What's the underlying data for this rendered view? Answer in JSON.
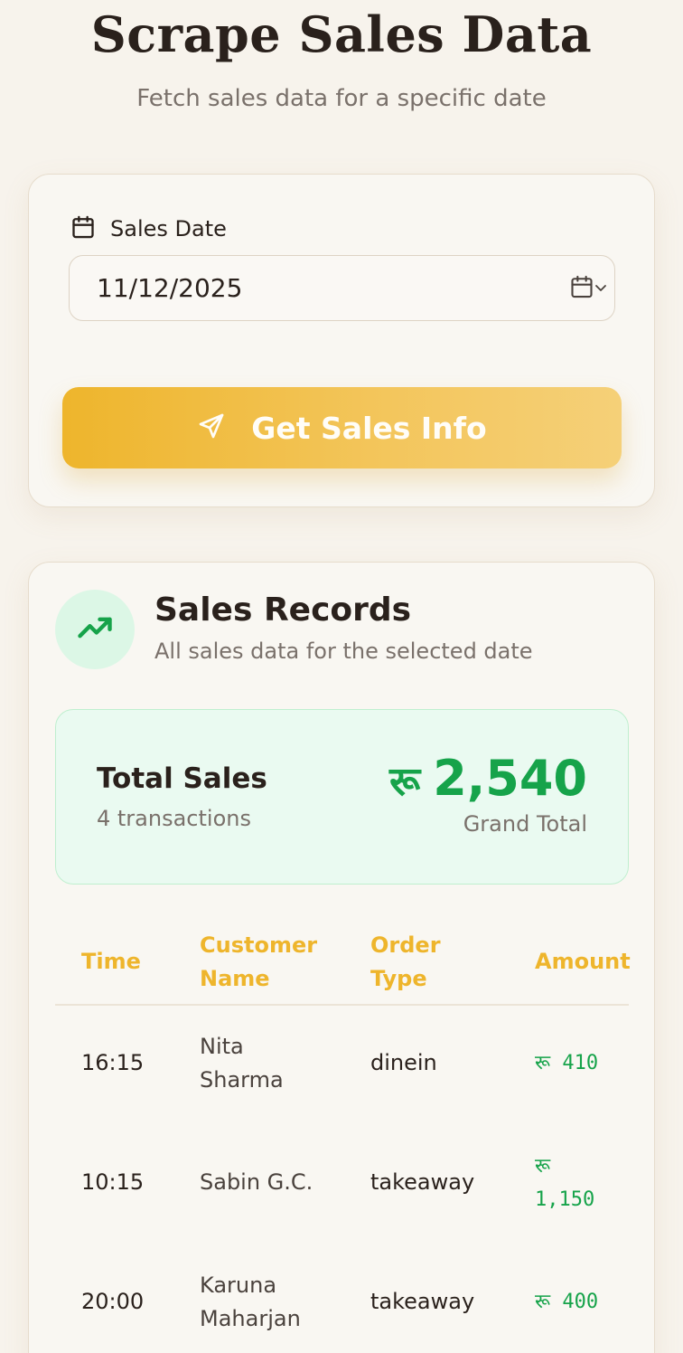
{
  "header": {
    "title": "Scrape Sales Data",
    "subtitle": "Fetch sales data for a specific date"
  },
  "form": {
    "date_label": "Sales Date",
    "date_value": "11/12/2025",
    "submit_label": "Get Sales Info"
  },
  "records": {
    "title": "Sales Records",
    "subtitle": "All sales data for the selected date",
    "summary": {
      "label": "Total Sales",
      "count_text": "4 transactions",
      "currency": "रू",
      "amount": "2,540",
      "amount_caption": "Grand Total"
    },
    "table": {
      "columns": [
        "Time",
        "Customer Name",
        "Order Type",
        "Amount"
      ],
      "rows": [
        {
          "time": "16:15",
          "customer": "Nita Sharma",
          "order_type": "dinein",
          "currency": "रू",
          "amount": "410"
        },
        {
          "time": "10:15",
          "customer": "Sabin G.C.",
          "order_type": "takeaway",
          "currency": "रू",
          "amount": "1,150"
        },
        {
          "time": "20:00",
          "customer": "Karuna Maharjan",
          "order_type": "takeaway",
          "currency": "रू",
          "amount": "400"
        }
      ]
    }
  },
  "colors": {
    "accent": "#eeb52c",
    "success": "#16a34a",
    "background": "#f7f3ec"
  },
  "icons": {
    "date_label": "calendar-icon",
    "picker": "calendar-icon",
    "submit": "send-icon",
    "records": "trending-up-icon"
  }
}
